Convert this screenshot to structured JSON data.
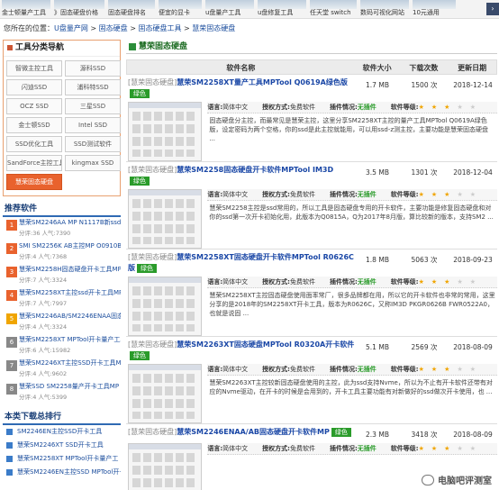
{
  "topstrip": {
    "items": [
      "金士顿量产工具",
      "》固态硬盘价格",
      "固态硬盘排名",
      "便宜的显卡",
      "u盘量产工具",
      "u盘修复工具",
      "任天堂 switch",
      "数码可视化网站",
      "10元通用"
    ],
    "scroll_icon": "chevron-right-icon"
  },
  "breadcrumb": {
    "prefix": "您所在的位置：",
    "items": [
      "U盘量产网",
      "固态硬盘",
      "固态硬盘工具",
      "慧荣固态硬盘"
    ],
    "sep": " > "
  },
  "left": {
    "category_title": "工具分类导航",
    "categories": [
      "智微主控工具",
      "源科SSD",
      "闪迪SSD",
      "浦科特SSD",
      "OCZ SSD",
      "三星SSD",
      "金士顿SSD",
      "Intel SSD",
      "SSD优化工具",
      "SSD测试软件",
      "SandForce主控工具",
      "kingmax SSD",
      "慧荣固态硬盘"
    ],
    "recommend_title": "推荐软件",
    "recommend": [
      {
        "num": "1",
        "color": "#e9622d",
        "title": "慧荣SM2246AA MP N1117B新ssd量产工",
        "meta": "分评:36  人气:7390"
      },
      {
        "num": "2",
        "color": "#e9622d",
        "title": "SMI SM2256K AB主控MP O0910B新工具",
        "meta": "分评:4  人气:7368"
      },
      {
        "num": "3",
        "color": "#e9622d",
        "title": "慧荣SM2258H固态硬盘开卡工具MP",
        "meta": "分评:7  人气:3324"
      },
      {
        "num": "4",
        "color": "#e9622d",
        "title": "慧荣SM2258XT主控ssd开卡工具MPTool",
        "meta": "分评:7  人气:7997"
      },
      {
        "num": "5",
        "color": "#f0a500",
        "title": "慧荣SM2246AB/SM2246ENAA固态硬盘",
        "meta": "分评:4  人气:3324"
      },
      {
        "num": "6",
        "color": "#888888",
        "title": "慧荣SM2258XT MPTool开卡量产工具",
        "meta": "分评:6  人气:15982"
      },
      {
        "num": "7",
        "color": "#888888",
        "title": "慧荣SM2246XT主控SSD开卡工具MP",
        "meta": "分评:4  人气:9602"
      },
      {
        "num": "8",
        "color": "#888888",
        "title": "慧荣SSD SM2258量产开卡工具MP C",
        "meta": "分评:4  人气:5399"
      }
    ],
    "rank_title": "本类下载总排行",
    "rank": [
      "SM2246EN主控SSD开卡工具",
      "慧荣SM2246XT SSD开卡工具",
      "慧荣SM2258XT MPTool开卡量产工",
      "慧荣SM2246EN主控SSD MPTool开卡工具"
    ]
  },
  "main": {
    "title": "慧荣固态硬盘",
    "headers": {
      "name": "软件名称",
      "size": "软件大小",
      "downloads": "下载次数",
      "updated": "更新日期"
    },
    "labels": {
      "lang": "语言:",
      "lang_val": "简体中文",
      "license": "授权方式:",
      "license_val": "免费软件",
      "plugin": "插件情况:",
      "plugin_val": "无插件",
      "rating": "软件等级:"
    },
    "badge": "绿色",
    "entries": [
      {
        "cat": "[慧荣固态硬盘]",
        "name": "慧荣SM2258XT量产工具MPTool Q0619A绿色版",
        "size": "1.7 MB",
        "downloads": "1500 次",
        "date": "2018-12-14",
        "stars": 3,
        "desc": "固态硬盘分主控，而最常见是慧荣主控，这里分享SM2258XT主控的量产工具MPTool Q0619A绿色版，设定密码为两个空格，你的ssd是此主控就能用，可以用ssd-z测主控，主要功能是慧荣固态硬盘 ..."
      },
      {
        "cat": "[慧荣固态硬盘]",
        "name": "慧荣SM2258固态硬盘开卡软件MPTool IM3D",
        "size": "3.5 MB",
        "downloads": "1301 次",
        "date": "2018-12-04",
        "stars": 3,
        "desc": "慧荣SM2258主控是ssd常用的，所以工具是固态硬盘专用的开卡软件，主要功能是修复固态硬盘和对你的ssd第一次开卡初始化用，此版本为Q0815A，Q为2017年8月版，算比较新的版本，支持SM2 ..."
      },
      {
        "cat": "[慧荣固态硬盘]",
        "name": "慧荣SM2258XT固态硬盘开卡软件MPTool R0626C版",
        "size": "1.8 MB",
        "downloads": "5063 次",
        "date": "2018-09-23",
        "stars": 3,
        "desc": "慧荣SM2258XT主控固态硬盘使用面率常厂，很多品牌都在用，所以它的开卡软件也非常的常用，这里分享的是2018年的SM2258XT开卡工具，版本为R0626C，又称IM3D PKGR0626B FWR0522A0，也就是说固 ..."
      },
      {
        "cat": "[慧荣固态硬盘]",
        "name": "慧荣SM2263XT固态硬盘MPTool R0320A开卡软件",
        "size": "5.1 MB",
        "downloads": "2569 次",
        "date": "2018-08-09",
        "stars": 3,
        "desc": "慧荣SM2263XT主控较新固态硬盘使用的主控，此为ssd支持Nvme，所以为不止有开卡软件还带有对应的Nvme驱动，在开卡的时候是会用到的，开卡工具主要功能有对新做好的ssd做次开卡使用，也 ..."
      },
      {
        "cat": "[慧荣固态硬盘]",
        "name": "慧荣SM2246ENAA/AB固态硬盘开卡软件MP",
        "size": "2.3 MB",
        "downloads": "3418 次",
        "date": "2018-08-09",
        "stars": 3,
        "desc": ""
      }
    ]
  },
  "watermark": "电脑吧评测室"
}
